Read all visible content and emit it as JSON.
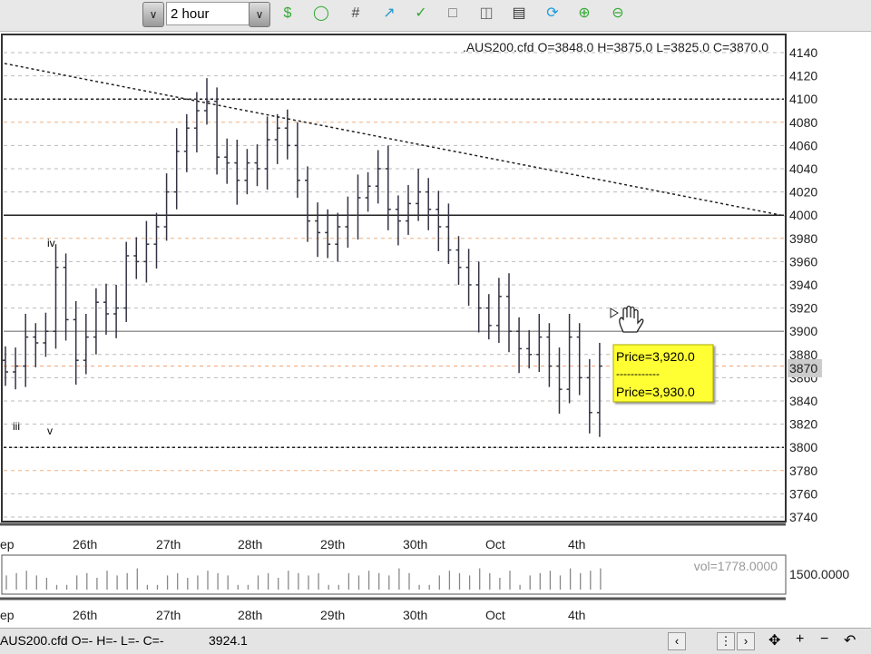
{
  "toolbar": {
    "timeframe": "2 hour",
    "icons": [
      "add-indicator-icon",
      "add-study-icon",
      "grid-icon",
      "chart-type-icon",
      "draw-line-icon",
      "template-icon",
      "copy-icon",
      "print-icon",
      "refresh-icon",
      "zoom-in-chart-icon",
      "zoom-out-chart-icon"
    ]
  },
  "chart_data": {
    "type": "ohlc",
    "symbol_label": ".AUS200.cfd O=3848.0 H=3875.0 L=3825.0 C=3870.0",
    "ylim": [
      3740,
      4140
    ],
    "y_ticks": [
      "4140",
      "4120",
      "4100",
      "4080",
      "4060",
      "4040",
      "4020",
      "4000",
      "3980",
      "3960",
      "3940",
      "3920",
      "3900",
      "3880",
      "3860",
      "3840",
      "3820",
      "3800",
      "3780",
      "3760",
      "3740"
    ],
    "current_price": "3870",
    "x_ticks": [
      "ep",
      "26th",
      "27th",
      "28th",
      "29th",
      "30th",
      "Oct",
      "4th"
    ],
    "closes": [
      3865,
      3870,
      3895,
      3890,
      3900,
      3955,
      3910,
      3875,
      3895,
      3925,
      3915,
      3920,
      3965,
      3960,
      3975,
      3990,
      4020,
      4055,
      4075,
      4090,
      4098,
      4050,
      4045,
      4030,
      4045,
      4040,
      4065,
      4075,
      4060,
      4030,
      3995,
      3985,
      3975,
      3990,
      4000,
      4015,
      4025,
      4040,
      4005,
      3995,
      4010,
      4020,
      4005,
      3990,
      3970,
      3955,
      3940,
      3920,
      3905,
      3930,
      3900,
      3885,
      3880,
      3895,
      3870,
      3850,
      3895,
      3860,
      3830,
      3870
    ],
    "wave_labels": [
      "iv",
      "iii",
      "v"
    ],
    "horizontal_lines": [
      4100,
      4000,
      3900,
      3800
    ],
    "volume": {
      "label": "vol=1778.0000",
      "axis_label": "1500.0000",
      "values": [
        6,
        7,
        8,
        6,
        5,
        2,
        2,
        6,
        7,
        5,
        8,
        6,
        7,
        9,
        2,
        2,
        6,
        7,
        5,
        6,
        8,
        7,
        6,
        2,
        2,
        6,
        7,
        5,
        8,
        7,
        6,
        7,
        2,
        2,
        7,
        6,
        8,
        7,
        6,
        9,
        7,
        2,
        2,
        6,
        8,
        7,
        6,
        9,
        7,
        5,
        8,
        2,
        6,
        7,
        8,
        6,
        9,
        7,
        8,
        9
      ]
    }
  },
  "tooltip": {
    "line1": "Price=3,920.0",
    "sep": "------------",
    "line2": "Price=3,930.0"
  },
  "status": {
    "symbol_text": "AUS200.cfd O=- H=- L=- C=-",
    "price": "3924.1"
  }
}
